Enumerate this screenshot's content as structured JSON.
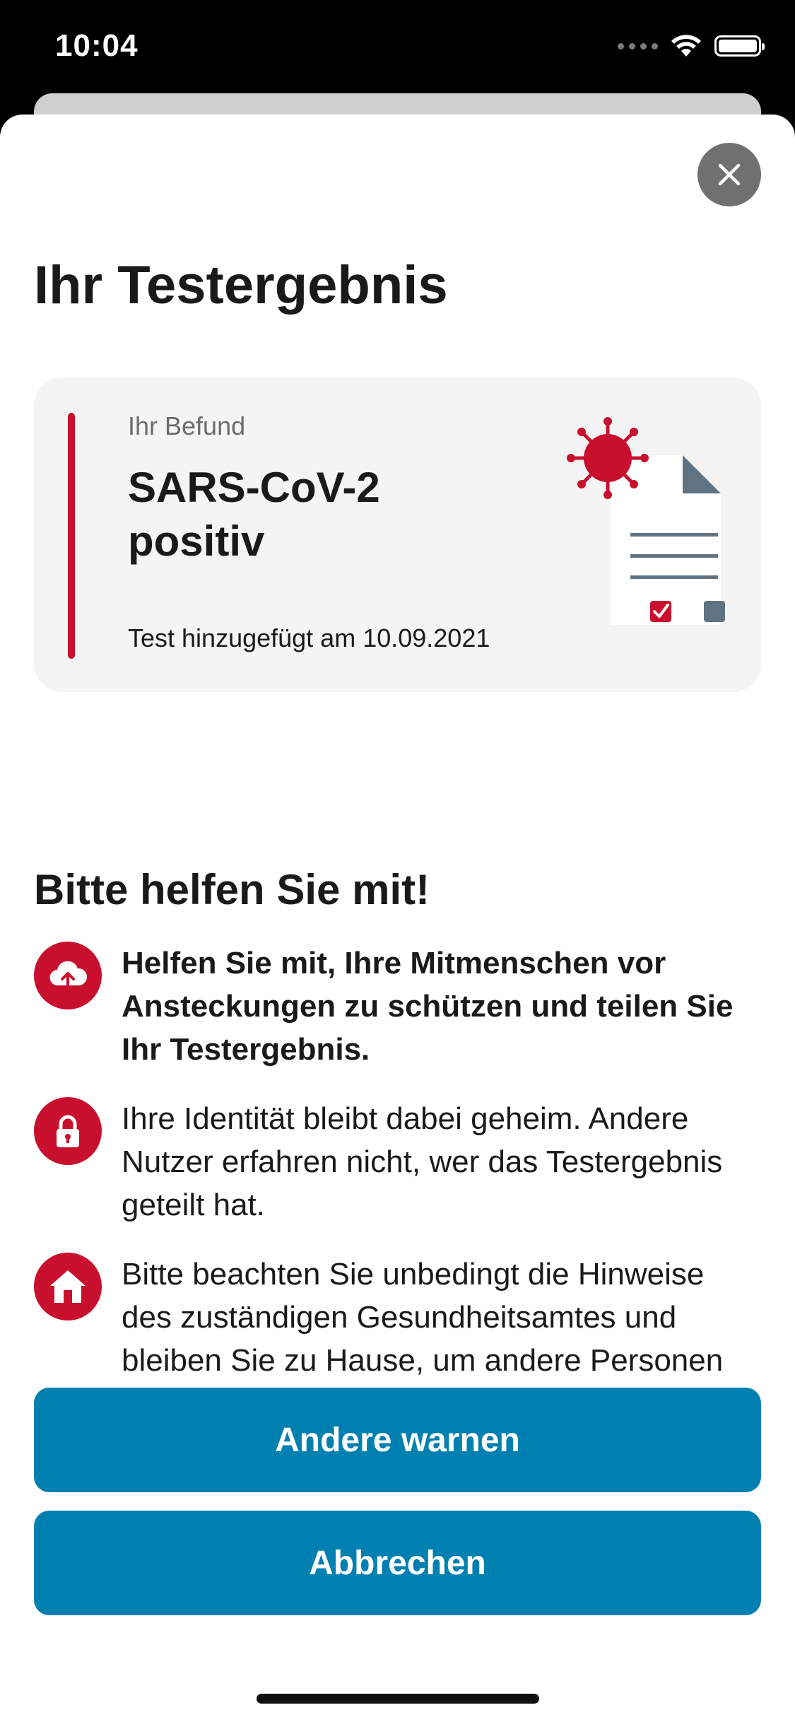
{
  "status_bar": {
    "time": "10:04"
  },
  "sheet": {
    "title": "Ihr Testergebnis",
    "close_icon": "close-icon"
  },
  "result_card": {
    "label": "Ihr Befund",
    "value": "SARS-CoV-2 positiv",
    "date_text": "Test hinzugefügt am 10.09.2021",
    "accent_color": "#c8102e",
    "illustration_icon": "test-document-virus-icon"
  },
  "help_section": {
    "title": "Bitte helfen Sie mit!",
    "items": [
      {
        "icon": "cloud-upload-icon",
        "text": "Helfen Sie mit, Ihre Mitmenschen vor Ansteckungen zu schützen und teilen Sie Ihr Testergebnis.",
        "bold": true
      },
      {
        "icon": "lock-icon",
        "text": "Ihre Identität bleibt dabei geheim. Andere Nutzer erfahren nicht, wer das Testergebnis geteilt hat.",
        "bold": false
      },
      {
        "icon": "home-icon",
        "text": "Bitte beachten Sie unbedingt die Hinweise des zuständigen Gesundheitsamtes und bleiben Sie zu Hause, um andere Personen nicht anzustecken.",
        "bold": false
      }
    ]
  },
  "buttons": {
    "warn_label": "Andere warnen",
    "cancel_label": "Abbrechen"
  },
  "colors": {
    "accent_red": "#c8102e",
    "button_blue": "#0080b0",
    "card_background": "#f4f4f4"
  }
}
